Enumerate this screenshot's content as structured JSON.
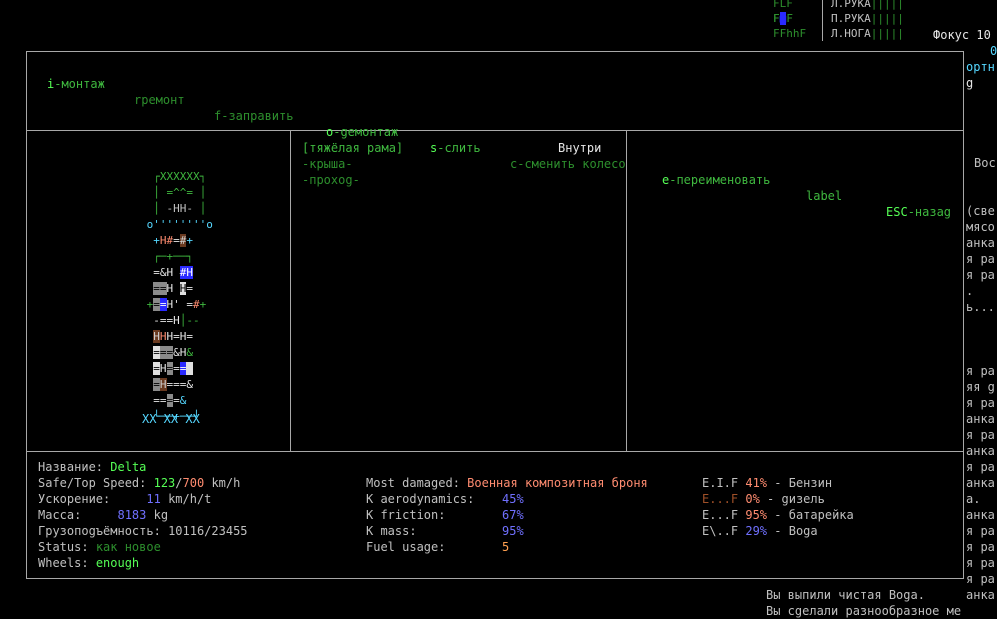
{
  "top_status": {
    "body_rows": [
      "Л.РУКА",
      "П.РУКА",
      "Л.НОГА"
    ],
    "bars": [
      "|||||",
      "|||||",
      "|||||"
    ],
    "mini_map": [
      "FLF",
      "F■F",
      "FFhhF"
    ],
    "focus": "Фокус 10",
    "right_num": "0"
  },
  "menu": {
    "items": [
      {
        "key": "i",
        "text": "-монтаж"
      },
      {
        "key": "",
        "text": "rремонт"
      },
      {
        "key": "",
        "text": "f-заправить"
      },
      {
        "key": "o",
        "text": "-gемонтаж"
      },
      {
        "key": "s",
        "text": "-слить"
      },
      {
        "key": "",
        "text": "c-сменить колесо"
      },
      {
        "key": "e",
        "text": "-переименовать"
      },
      {
        "key": "",
        "text": "label"
      },
      {
        "key": "ESC",
        "text": "-назаg"
      }
    ]
  },
  "parts_panel": {
    "selected": "[тяжёлая рама]",
    "location": "Внутри",
    "items": [
      "-крыша-",
      "-прохоg-"
    ]
  },
  "vehicle_art": {
    "wheels_label": "XX XX XX",
    "top_label": "XXXXXX"
  },
  "stats": {
    "name_label": "Название:",
    "name_value": "Delta",
    "speed_label": "Safe/Top Speed:",
    "speed_safe": "123",
    "speed_top": "700",
    "speed_unit": "km/h",
    "accel_label": "Ускорение:",
    "accel_value": "11",
    "accel_unit": "km/h/t",
    "mass_label": "Масса:",
    "mass_value": "8183",
    "mass_unit": "kg",
    "cargo_label": "Грузопоgъёмность:",
    "cargo_value": "10116/23455",
    "status_label": "Status:",
    "status_value": "как новое",
    "wheels_label": "Wheels:",
    "wheels_value": "enough"
  },
  "condition": {
    "most_damaged_label": "Most damaged:",
    "most_damaged_value": "Военная композитная броня",
    "k_aero_label": "K aerodynamics:",
    "k_aero_value": "45%",
    "k_friction_label": "K friction:",
    "k_friction_value": "67%",
    "k_mass_label": "K mass:",
    "k_mass_value": "95%",
    "fuel_label": "Fuel usage:",
    "fuel_value": "5"
  },
  "tanks": [
    {
      "gauge": "E.I.F",
      "pct": "41%",
      "name": "- Бензин"
    },
    {
      "gauge": "E...F",
      "pct": "0%",
      "name": "- gизель"
    },
    {
      "gauge": "E...F",
      "pct": "95%",
      "name": "- батарейка"
    },
    {
      "gauge": "E\\..F",
      "pct": "29%",
      "name": "- Bоgа"
    }
  ],
  "side_text": {
    "top": [
      "ортн",
      "g"
    ],
    "mid": [
      "Вос"
    ],
    "list": [
      "(све",
      "мясо",
      "анка",
      "я ра",
      "я ра",
      ".",
      "ь..."
    ],
    "list2": [
      "я ра",
      "яя g",
      "я ра",
      "анка",
      "я ра",
      "анка",
      "я ра",
      "анка",
      "а.",
      "анка",
      "я ра"
    ],
    "list3": [
      "я ра",
      "я ра",
      "я ра",
      "анка"
    ]
  },
  "log": {
    "line1": "Вы выпили чистая Bоgа.",
    "line2": "Вы сgелали разнообразное ме"
  }
}
